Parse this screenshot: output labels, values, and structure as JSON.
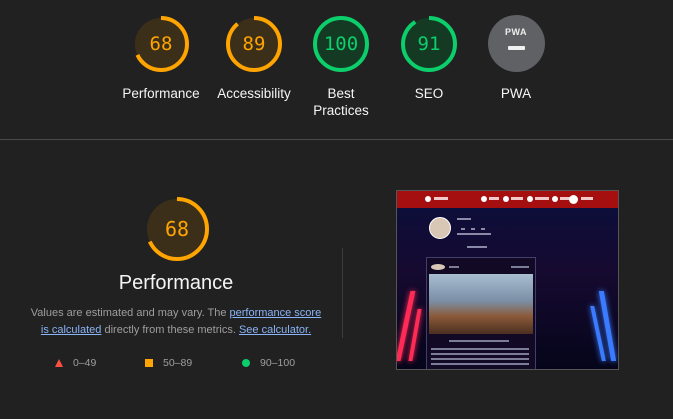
{
  "categories": [
    {
      "label": "Performance",
      "score": "68",
      "value": 0.68,
      "color": "#ffa400",
      "track": "#3b2f1a"
    },
    {
      "label": "Accessibility",
      "score": "89",
      "value": 0.89,
      "color": "#ffa400",
      "track": "#3b2f1a"
    },
    {
      "label": "Best\nPractices",
      "score": "100",
      "value": 1.0,
      "color": "#0cce6b",
      "track": "#153a24"
    },
    {
      "label": "SEO",
      "score": "91",
      "value": 0.91,
      "color": "#0cce6b",
      "track": "#153a24"
    }
  ],
  "pwa": {
    "label": "PWA",
    "badge_text": "PWA",
    "icon": "pwa-badge-icon"
  },
  "performance": {
    "score": "68",
    "value": 0.68,
    "color": "#ffa400",
    "title": "Performance",
    "desc_prefix": "Values are estimated and may vary. The ",
    "link1": "performance score is calculated",
    "desc_middle": " directly from these metrics. ",
    "link2": "See calculator."
  },
  "legend": [
    {
      "icon": "fail-triangle-icon",
      "range": "0–49",
      "color": "#ff4e42"
    },
    {
      "icon": "average-square-icon",
      "range": "50–89",
      "color": "#ffa400"
    },
    {
      "icon": "pass-circle-icon",
      "range": "90–100",
      "color": "#0cce6b"
    }
  ],
  "screenshot": {
    "icon": "final-screenshot-thumbnail"
  }
}
